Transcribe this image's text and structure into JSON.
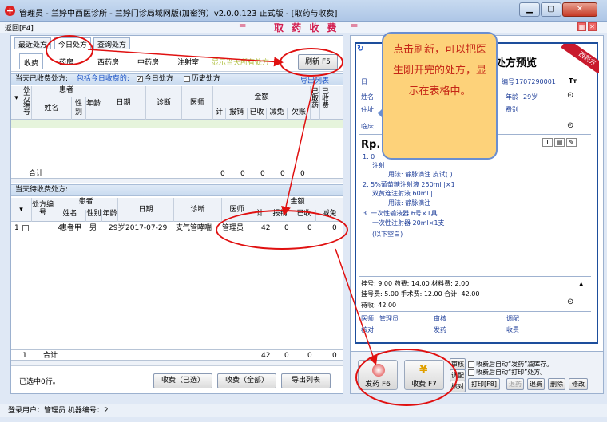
{
  "window": {
    "title": "管理员 - 兰婷中西医诊所 - 兰婷门诊局域网版(加密狗）v2.0.0.123 正式版 - [取药与收费]",
    "min_icon": "minimize-icon",
    "max_icon": "maximize-icon",
    "close_icon": "close-icon"
  },
  "toolbar": {
    "back_label": "返回[F4]",
    "module_title": "取 药 收 费",
    "eq": "═"
  },
  "tabs": [
    "最近处方",
    "今日处方",
    "查询处方"
  ],
  "subtabs": [
    "收费",
    "药房",
    "西药房",
    "中药房",
    "注射室"
  ],
  "subtab_hint": "显示当天所有处方",
  "refresh_label": "刷新 F5",
  "paid_section": {
    "label": "当天已收费处方:",
    "include_label": "包括今日收费的:",
    "today_label": "今日处方",
    "history_label": "历史处方",
    "export_label": "导出列表"
  },
  "grid1_headers": {
    "rx_no": "处方编号",
    "patient": "患者",
    "name": "姓名",
    "sex": "性别",
    "age": "年龄",
    "date": "日期",
    "diagnosis": "诊断",
    "doctor": "医师",
    "amount": "金额",
    "total": "计",
    "refund": "报销",
    "paid": "已收",
    "discount": "减免",
    "owed": "欠账",
    "dispensed": "已取药",
    "charged": "已收费"
  },
  "grid1_total": {
    "label": "合计",
    "values": [
      "0",
      "0",
      "0",
      "0",
      "0"
    ]
  },
  "pending_section": {
    "label": "当天待收费处方:"
  },
  "grid2_headers": {
    "rx_no": "处方编号",
    "patient": "患者",
    "name": "姓名",
    "sex": "性别",
    "age": "年龄",
    "date": "日期",
    "diagnosis": "诊断",
    "doctor": "医师",
    "amount": "金额",
    "total": "计",
    "refund": "报销",
    "paid": "已收",
    "discount": "减免"
  },
  "grid2_rows": [
    {
      "idx": "1",
      "rx_no": "4",
      "name": "患者甲",
      "sex": "男",
      "age": "29岁",
      "date": "2017-07-29",
      "diagnosis": "支气管哮喘",
      "doctor": "管理员",
      "total": "42",
      "refund": "0",
      "paid": "0",
      "discount": "0"
    }
  ],
  "grid2_total": {
    "idx": "1",
    "label": "合计",
    "values": [
      "42",
      "0",
      "0",
      "0"
    ]
  },
  "selection_status": "已选中0行。",
  "bottom_buttons": [
    "收费（已选）",
    "收费（全部）",
    "导出列表"
  ],
  "status_bar": "登录用户：管理员   机器编号：2",
  "rx": {
    "title": "处方预览",
    "ribbon": "西药方",
    "no_label": "编号",
    "no_value": "1707290001",
    "name_label": "姓名",
    "age_label": "年龄",
    "age_value": "29岁",
    "addr_label": "住址",
    "fee_label": "费别",
    "diag_label": "临床",
    "rp": "Rp.",
    "lines": [
      "1. 0",
      "注射",
      "用法: 静脉滴注 皮试(  )",
      "2. 5%葡萄糖注射液    250ml |×1",
      "双黄连注射液      60ml  |",
      "用法: 静脉滴注",
      "3. 一次性输液器        6号×1具",
      "一次性注射器        20ml×1支",
      "(以下空白)"
    ],
    "fees": [
      "挂号: 9.00      药费: 14.00     材料费: 2.00",
      "挂号费: 5.00    手术费: 12.00  合计: 42.00",
      "待收: 42.00"
    ],
    "sign": {
      "doctor_label": "医师",
      "doctor_value": "管理员",
      "review": "审核",
      "prepare": "调配",
      "check": "核对",
      "dispense": "发药",
      "charge": "收费"
    }
  },
  "callout": "点击刷新，可以把医生刚开完的处方，显示在表格中。",
  "actions": {
    "dispense": "发药 F6",
    "charge": "收费 F7",
    "review": "审核",
    "prepare": "调配",
    "check": "核对",
    "print": "打印[F8]",
    "auto_dispense": "收费后自动“发药”减库存。",
    "auto_print": "收费后自动“打印”处方。",
    "refund_dispense": "退药",
    "refund_fee": "退费",
    "delete": "删除",
    "edit": "修改"
  },
  "colors": {
    "accent_red": "#d21d4f",
    "link_blue": "#1a52c6",
    "callout_bg": "#fdd27a",
    "annotation_red": "#e01010"
  }
}
